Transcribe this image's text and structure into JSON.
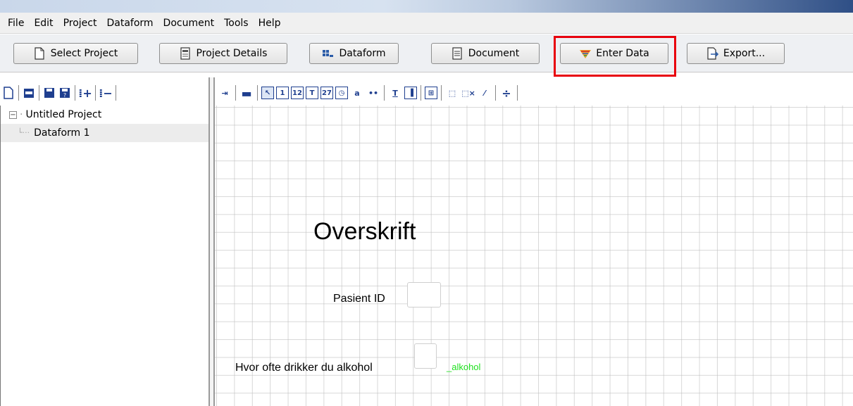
{
  "menubar": {
    "items": [
      "File",
      "Edit",
      "Project",
      "Dataform",
      "Document",
      "Tools",
      "Help"
    ]
  },
  "toolbar": {
    "select_project": "Select Project",
    "project_details": "Project Details",
    "dataform": "Dataform",
    "document": "Document",
    "enter_data": "Enter Data",
    "export": "Export..."
  },
  "tree": {
    "root": "Untitled Project",
    "child": "Dataform 1"
  },
  "canvas": {
    "heading": "Overskrift",
    "pasient_label": "Pasient ID",
    "alkohol_label": "Hvor ofte drikker du alkohol",
    "alkohol_varname": "_alkohol"
  },
  "colors": {
    "highlight": "#e8000d",
    "varname": "#1ee01e",
    "icon": "#1f3f8f"
  }
}
